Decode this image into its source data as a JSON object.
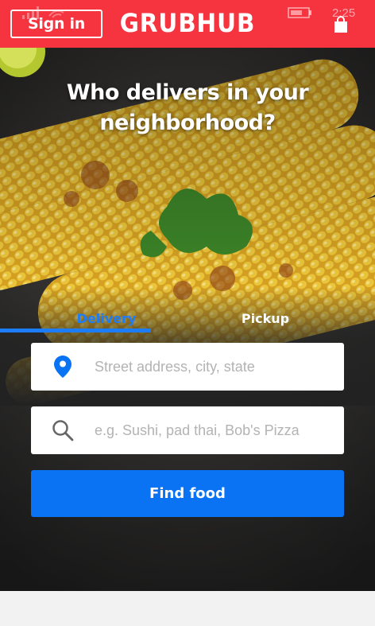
{
  "header": {
    "signin_label": "Sign in",
    "logo_text": "GRUBHUB",
    "time": "2:25",
    "brand_color": "#f63440"
  },
  "hero": {
    "headline": "Who delivers in your neighborhood?"
  },
  "tabs": {
    "items": [
      {
        "label": "Delivery",
        "active": true
      },
      {
        "label": "Pickup",
        "active": false
      }
    ]
  },
  "search": {
    "address_placeholder": "Street address, city, state",
    "food_placeholder": "e.g. Sushi, pad thai, Bob's Pizza",
    "address_icon": "location-pin-icon",
    "food_icon": "search-icon"
  },
  "actions": {
    "find_food_label": "Find food",
    "accent_color": "#0a73f4"
  }
}
